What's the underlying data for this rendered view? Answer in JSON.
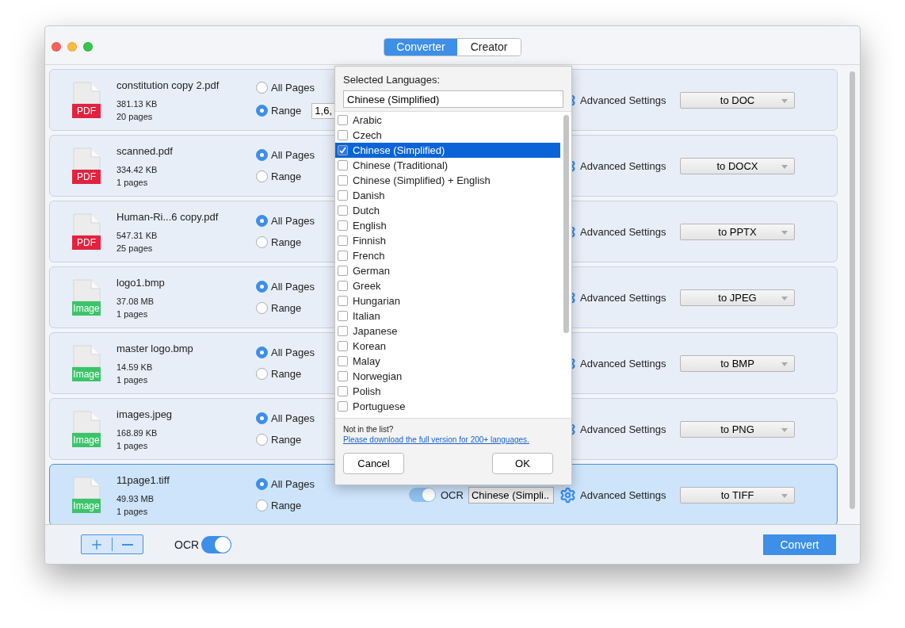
{
  "tabs": [
    {
      "label": "Converter",
      "selected": true
    },
    {
      "label": "Creator",
      "selected": false
    }
  ],
  "files": [
    {
      "name": "constitution copy 2.pdf",
      "size": "381.13 KB",
      "pages": "20 pages",
      "kind": "pdf",
      "badge": "PDF",
      "selected": false,
      "page_options": [
        {
          "label": "All Pages",
          "selected": false
        },
        {
          "label": "Range",
          "selected": true
        }
      ],
      "range_value": "1,6,",
      "advanced": "Advanced Settings",
      "format": "to DOC"
    },
    {
      "name": "scanned.pdf",
      "size": "334.42 KB",
      "pages": "1 pages",
      "kind": "pdf",
      "badge": "PDF",
      "selected": false,
      "page_options": [
        {
          "label": "All Pages",
          "selected": true
        },
        {
          "label": "Range",
          "selected": false
        }
      ],
      "advanced": "Advanced Settings",
      "format": "to DOCX"
    },
    {
      "name": "Human-Ri...6 copy.pdf",
      "size": "547.31 KB",
      "pages": "25 pages",
      "kind": "pdf",
      "badge": "PDF",
      "selected": false,
      "page_options": [
        {
          "label": "All Pages",
          "selected": true
        },
        {
          "label": "Range",
          "selected": false
        }
      ],
      "advanced": "Advanced Settings",
      "format": "to PPTX"
    },
    {
      "name": "logo1.bmp",
      "size": "37.08 MB",
      "pages": "1 pages",
      "kind": "image",
      "badge": "Image",
      "selected": false,
      "page_options": [
        {
          "label": "All Pages",
          "selected": true
        },
        {
          "label": "Range",
          "selected": false
        }
      ],
      "advanced": "Advanced Settings",
      "format": "to JPEG"
    },
    {
      "name": "master logo.bmp",
      "size": "14.59 KB",
      "pages": "1 pages",
      "kind": "image",
      "badge": "Image",
      "selected": false,
      "page_options": [
        {
          "label": "All Pages",
          "selected": true
        },
        {
          "label": "Range",
          "selected": false
        }
      ],
      "advanced": "Advanced Settings",
      "format": "to BMP"
    },
    {
      "name": "images.jpeg",
      "size": "168.89 KB",
      "pages": "1 pages",
      "kind": "image",
      "badge": "Image",
      "selected": false,
      "page_options": [
        {
          "label": "All Pages",
          "selected": true
        },
        {
          "label": "Range",
          "selected": false
        }
      ],
      "advanced": "Advanced Settings",
      "format": "to PNG"
    },
    {
      "name": "11page1.tiff",
      "size": "49.93 MB",
      "pages": "1 pages",
      "kind": "image",
      "badge": "Image",
      "selected": true,
      "page_options": [
        {
          "label": "All Pages",
          "selected": true
        },
        {
          "label": "Range",
          "selected": false
        }
      ],
      "ocr": {
        "on": true,
        "label": "OCR",
        "language": "Chinese (Simpli.."
      },
      "advanced": "Advanced Settings",
      "format": "to TIFF"
    }
  ],
  "language_popover": {
    "title": "Selected Languages:",
    "value": "Chinese (Simplified)",
    "languages": [
      {
        "label": "Arabic",
        "checked": false,
        "selected": false
      },
      {
        "label": "Czech",
        "checked": false,
        "selected": false
      },
      {
        "label": "Chinese (Simplified)",
        "checked": true,
        "selected": true
      },
      {
        "label": "Chinese (Traditional)",
        "checked": false,
        "selected": false
      },
      {
        "label": "Chinese (Simplified) + English",
        "checked": false,
        "selected": false
      },
      {
        "label": "Danish",
        "checked": false,
        "selected": false
      },
      {
        "label": "Dutch",
        "checked": false,
        "selected": false
      },
      {
        "label": "English",
        "checked": false,
        "selected": false
      },
      {
        "label": "Finnish",
        "checked": false,
        "selected": false
      },
      {
        "label": "French",
        "checked": false,
        "selected": false
      },
      {
        "label": "German",
        "checked": false,
        "selected": false
      },
      {
        "label": "Greek",
        "checked": false,
        "selected": false
      },
      {
        "label": "Hungarian",
        "checked": false,
        "selected": false
      },
      {
        "label": "Italian",
        "checked": false,
        "selected": false
      },
      {
        "label": "Japanese",
        "checked": false,
        "selected": false
      },
      {
        "label": "Korean",
        "checked": false,
        "selected": false
      },
      {
        "label": "Malay",
        "checked": false,
        "selected": false
      },
      {
        "label": "Norwegian",
        "checked": false,
        "selected": false
      },
      {
        "label": "Polish",
        "checked": false,
        "selected": false
      },
      {
        "label": "Portuguese",
        "checked": false,
        "selected": false
      }
    ],
    "note": "Not in the list?",
    "link": "Please download the full version for 200+ languages.",
    "buttons": [
      "Cancel",
      "OK"
    ]
  },
  "bottom_bar": {
    "ocr_label": "OCR",
    "ocr_on": true,
    "convert": "Convert"
  }
}
